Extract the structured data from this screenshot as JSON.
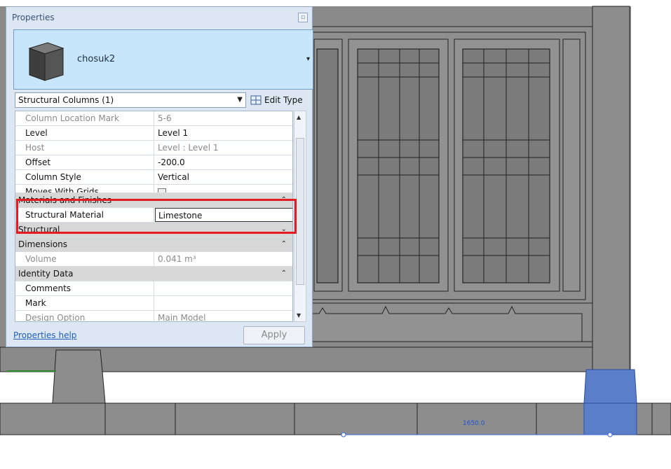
{
  "panel": {
    "title": "Properties",
    "type_name": "chosuk2",
    "category_selector": "Structural Columns (1)",
    "edit_type_label": "Edit Type",
    "help_link": "Properties help",
    "apply_label": "Apply"
  },
  "rows": [
    {
      "key": "Column Location Mark",
      "value": "5-6"
    },
    {
      "key": "Level",
      "value": "Level 1"
    },
    {
      "key": "Host",
      "value": "Level : Level 1"
    },
    {
      "key": "Offset",
      "value": "-200.0"
    },
    {
      "key": "Column Style",
      "value": "Vertical"
    },
    {
      "key": "Moves With Grids",
      "value": ""
    },
    {
      "group": "Materials and Finishes"
    },
    {
      "key": "Structural Material",
      "value": "Limestone"
    },
    {
      "group": "Structural"
    },
    {
      "group": "Dimensions"
    },
    {
      "key": "Volume",
      "value": "0.041 m³"
    },
    {
      "group": "Identity Data"
    },
    {
      "key": "Comments",
      "value": ""
    },
    {
      "key": "Mark",
      "value": ""
    },
    {
      "key": "Design Option",
      "value": "Main Model"
    }
  ],
  "viewport": {
    "dimension_label": "1650.0"
  },
  "colors": {
    "selection_highlight": "#e41b23",
    "selected_element": "#5b7ec9",
    "panel_bg": "#dde7f3"
  }
}
